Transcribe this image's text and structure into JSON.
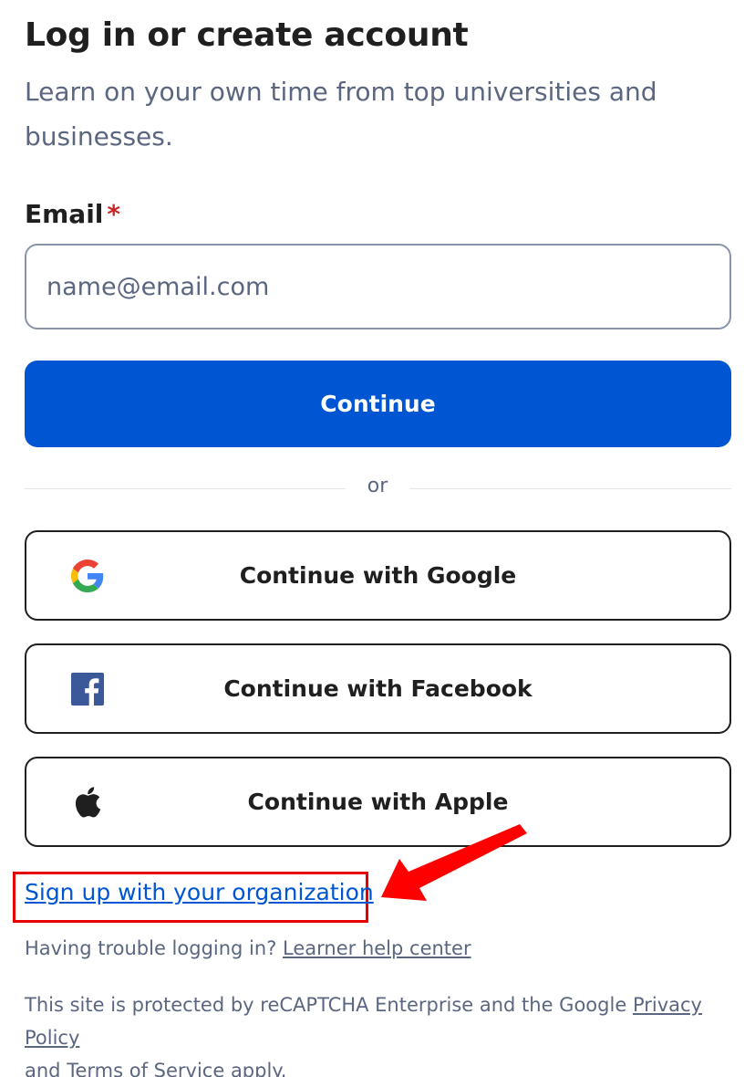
{
  "header": {
    "title": "Log in or create account",
    "subtitle": "Learn on your own time from top universities and businesses."
  },
  "email": {
    "label": "Email",
    "required_mark": "*",
    "placeholder": "name@email.com",
    "value": ""
  },
  "primary_button": {
    "label": "Continue"
  },
  "divider": {
    "text": "or"
  },
  "social_buttons": [
    {
      "label": "Continue with Google",
      "icon": "google-icon"
    },
    {
      "label": "Continue with Facebook",
      "icon": "facebook-icon"
    },
    {
      "label": "Continue with Apple",
      "icon": "apple-icon"
    }
  ],
  "org_link": {
    "label": "Sign up with your organization"
  },
  "help": {
    "text": "Having trouble logging in?",
    "link": "Learner help center"
  },
  "legal": {
    "prefix": "This site is protected by reCAPTCHA Enterprise and the Google",
    "privacy_link": "Privacy Policy",
    "and": "and",
    "terms_link": "Terms of Service",
    "suffix": "apply."
  },
  "annotation": {
    "highlight_color": "#e60000",
    "arrow_color": "#ff0000"
  },
  "colors": {
    "primary": "#0056d2",
    "text": "#1f1f1f",
    "muted": "#5b6780"
  }
}
